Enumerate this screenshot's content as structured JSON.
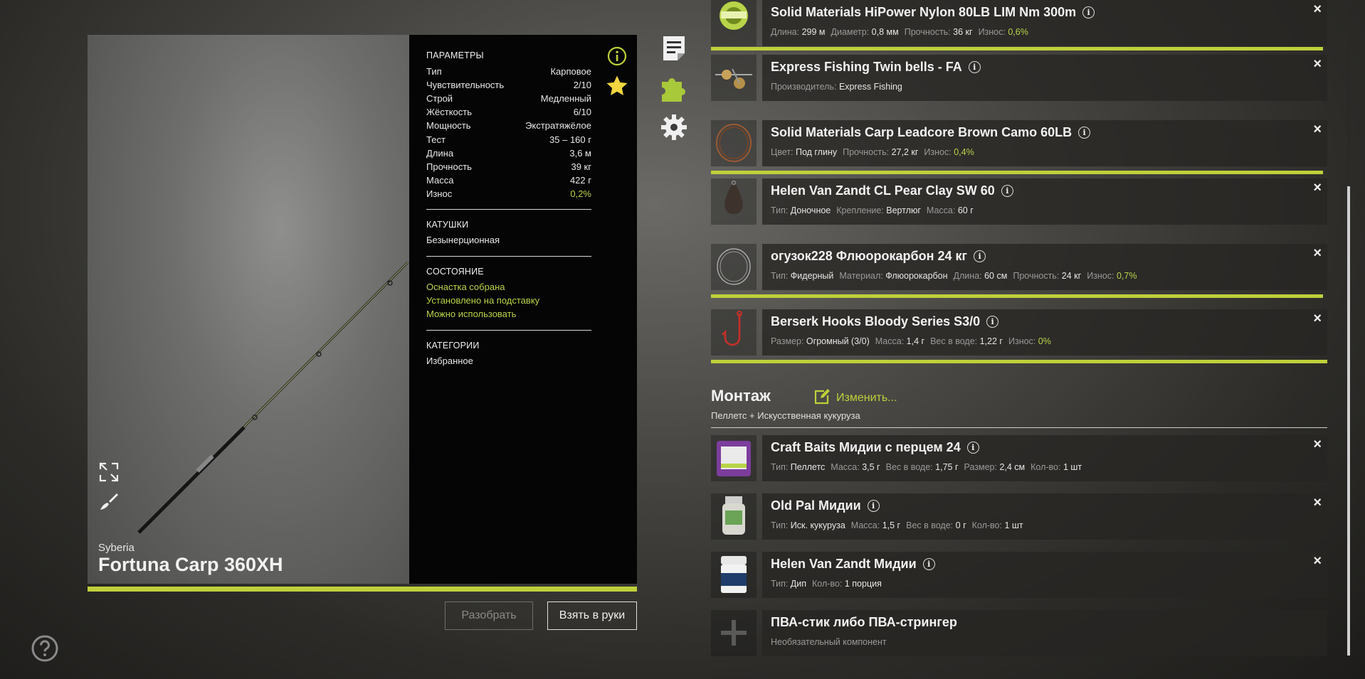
{
  "rod": {
    "brand": "Syberia",
    "name": "Fortuna Carp 360XH",
    "params_title": "ПАРАМЕТРЫ",
    "params": [
      {
        "k": "Тип",
        "v": "Карповое"
      },
      {
        "k": "Чувствительность",
        "v": "2/10"
      },
      {
        "k": "Строй",
        "v": "Медленный"
      },
      {
        "k": "Жёсткость",
        "v": "6/10"
      },
      {
        "k": "Мощность",
        "v": "Экстратяжёлое"
      },
      {
        "k": "Тест",
        "v": "35 – 160 г"
      },
      {
        "k": "Длина",
        "v": "3,6 м"
      },
      {
        "k": "Прочность",
        "v": "39 кг"
      },
      {
        "k": "Масса",
        "v": "422 г"
      },
      {
        "k": "Износ",
        "v": "0,2%"
      }
    ],
    "reels_title": "КАТУШКИ",
    "reels_value": "Безынерционная",
    "state_title": "СОСТОЯНИЕ",
    "state": [
      "Оснастка собрана",
      "Установлено на подставку",
      "Можно использовать"
    ],
    "categories_title": "КАТЕГОРИИ",
    "categories_value": "Избранное",
    "accent": "#bfd03a"
  },
  "buttons": {
    "disassemble": "Разобрать",
    "take": "Взять в руки"
  },
  "items": [
    {
      "title": "Solid Materials HiPower Nylon 80LB LIM Nm 300m",
      "props": [
        {
          "k": "Длина:",
          "v": "299 м"
        },
        {
          "k": "Диаметр:",
          "v": "0,8 мм"
        },
        {
          "k": "Прочность:",
          "v": "36 кг"
        },
        {
          "k": "Износ:",
          "v": "0,6%",
          "green": true
        }
      ]
    },
    {
      "title": "Express Fishing Twin bells - FA",
      "props": [
        {
          "k": "Производитель:",
          "v": "Express Fishing"
        }
      ]
    },
    {
      "title": "Solid Materials Carp Leadcore Brown Camo 60LB",
      "props": [
        {
          "k": "Цвет:",
          "v": "Под глину"
        },
        {
          "k": "Прочность:",
          "v": "27,2 кг"
        },
        {
          "k": "Износ:",
          "v": "0,4%",
          "green": true
        }
      ]
    },
    {
      "title": "Helen Van Zandt CL Pear Clay SW 60",
      "props": [
        {
          "k": "Тип:",
          "v": "Доночное"
        },
        {
          "k": "Крепление:",
          "v": "Вертлюг"
        },
        {
          "k": "Масса:",
          "v": "60 г"
        }
      ]
    },
    {
      "title": "огузок228 Флюорокарбон 24 кг",
      "props": [
        {
          "k": "Тип:",
          "v": "Фидерный"
        },
        {
          "k": "Материал:",
          "v": "Флюорокарбон"
        },
        {
          "k": "Длина:",
          "v": "60 см"
        },
        {
          "k": "Прочность:",
          "v": "24 кг"
        },
        {
          "k": "Износ:",
          "v": "0,7%",
          "green": true
        }
      ]
    },
    {
      "title": "Berserk Hooks Bloody Series S3/0",
      "props": [
        {
          "k": "Размер:",
          "v": "Огромный (3/0)"
        },
        {
          "k": "Масса:",
          "v": "1,4 г"
        },
        {
          "k": "Вес в воде:",
          "v": "1,22 г"
        },
        {
          "k": "Износ:",
          "v": "0%",
          "green": true
        }
      ]
    }
  ],
  "montage": {
    "title": "Монтаж",
    "edit_label": "Изменить...",
    "subtitle": "Пеллетс  +  Искусственная кукуруза"
  },
  "bait_items": [
    {
      "title": "Craft Baits Мидии с перцем 24",
      "props": [
        {
          "k": "Тип:",
          "v": "Пеллетс"
        },
        {
          "k": "Масса:",
          "v": "3,5 г"
        },
        {
          "k": "Вес в воде:",
          "v": "1,75 г"
        },
        {
          "k": "Размер:",
          "v": "2,4 см"
        },
        {
          "k": "Кол-во:",
          "v": "1 шт"
        }
      ]
    },
    {
      "title": "Old Pal Мидии",
      "props": [
        {
          "k": "Тип:",
          "v": "Иск. кукуруза"
        },
        {
          "k": "Масса:",
          "v": "1,5 г"
        },
        {
          "k": "Вес в воде:",
          "v": "0 г"
        },
        {
          "k": "Кол-во:",
          "v": "1 шт"
        }
      ]
    },
    {
      "title": "Helen Van Zandt Мидии",
      "props": [
        {
          "k": "Тип:",
          "v": "Дип"
        },
        {
          "k": "Кол-во:",
          "v": "1 порция"
        }
      ]
    },
    {
      "title": "ПВА-стик либо ПВА-стрингер",
      "subtitle": "Необязательный компонент"
    }
  ],
  "icons": {
    "close": "×",
    "info": "i"
  }
}
